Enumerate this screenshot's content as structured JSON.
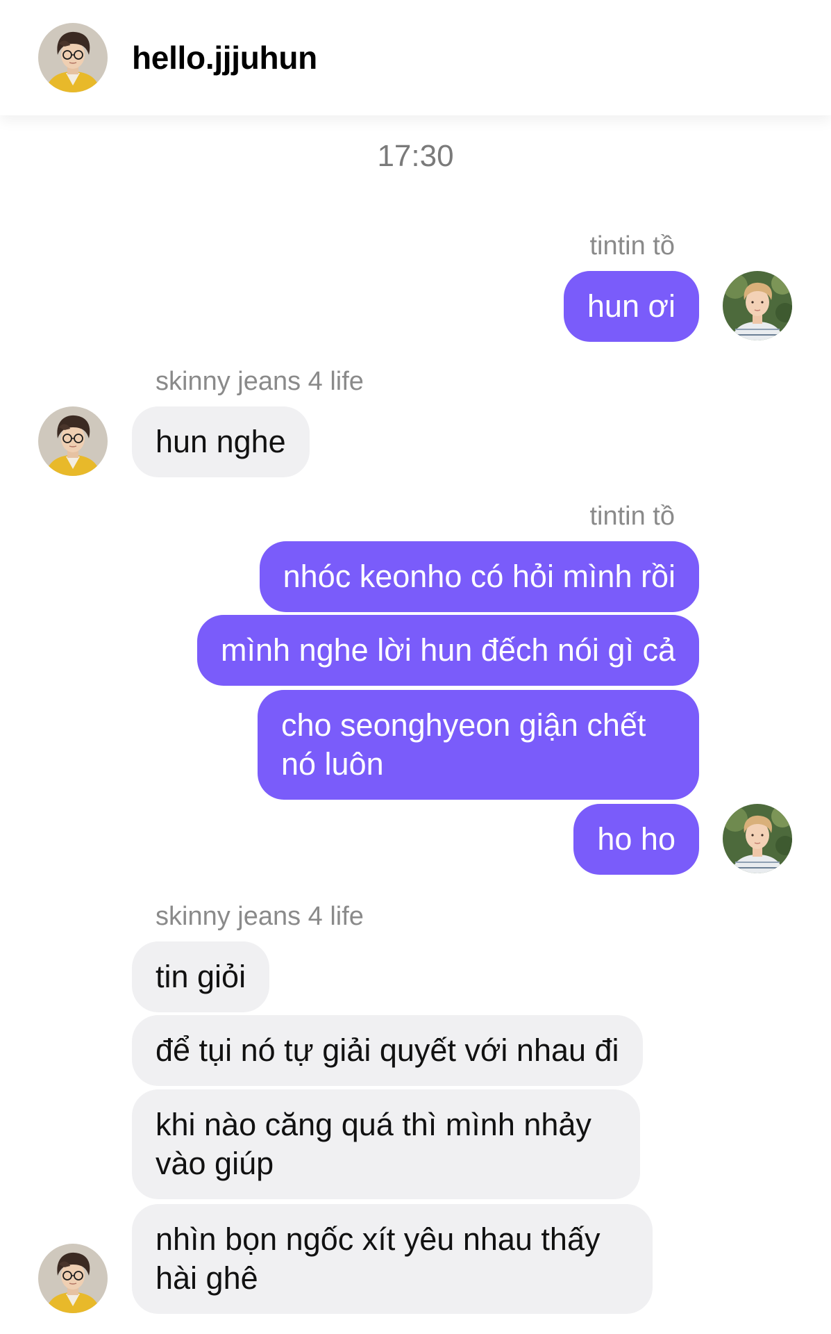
{
  "header": {
    "username": "hello.jjjuhun"
  },
  "conversation": {
    "timestamp": "17:30",
    "groups": [
      {
        "direction": "outgoing",
        "sender": "tintin tồ",
        "messages": [
          "hun ơi"
        ]
      },
      {
        "direction": "incoming",
        "sender": "skinny jeans 4 life",
        "messages": [
          "hun nghe"
        ]
      },
      {
        "direction": "outgoing",
        "sender": "tintin tồ",
        "messages": [
          "nhóc keonho có hỏi mình rồi",
          "mình nghe lời hun đếch nói gì cả",
          "cho seonghyeon giận chết nó luôn",
          "ho ho"
        ]
      },
      {
        "direction": "incoming",
        "sender": "skinny jeans 4 life",
        "messages": [
          "tin giỏi",
          "để tụi nó tự giải quyết với nhau đi",
          "khi nào căng quá thì mình nhảy vào giúp",
          "nhìn bọn ngốc xít yêu nhau thấy hài ghê"
        ]
      }
    ]
  },
  "colors": {
    "outgoing_bubble": "#7a5cfa",
    "incoming_bubble": "#f0f0f2",
    "sender_label": "#8a8a8a",
    "timestamp": "#7a7a7a"
  },
  "icons": {
    "contact_avatar": "contact-avatar-photo",
    "self_avatar": "self-avatar-photo"
  }
}
